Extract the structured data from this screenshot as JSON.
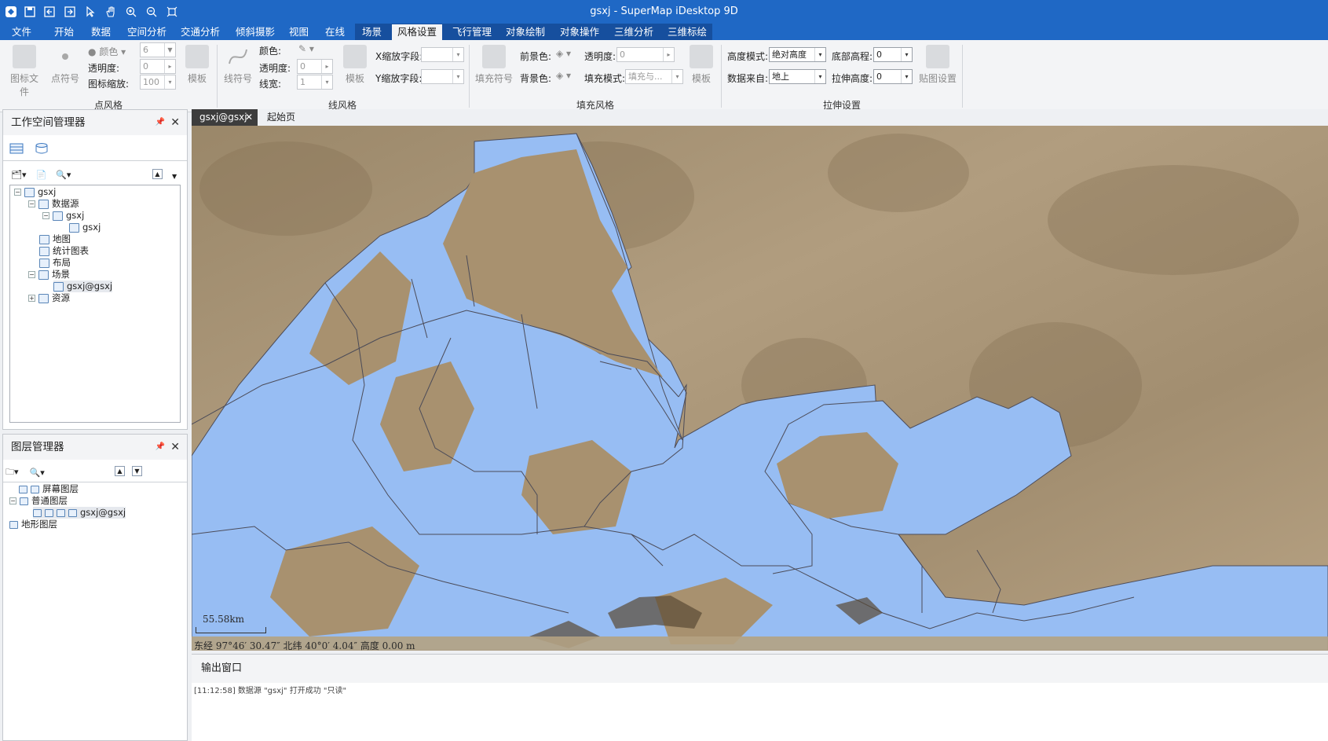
{
  "window": {
    "title": "gsxj - SuperMap iDesktop 9D"
  },
  "quick_access": [
    "app-logo-icon",
    "save-icon",
    "open-icon",
    "close-file-icon",
    "select-icon",
    "pan-icon",
    "zoom-in-icon",
    "zoom-out-icon",
    "full-extent-icon"
  ],
  "menu": {
    "tabs": [
      {
        "label": "文件"
      },
      {
        "label": "开始"
      },
      {
        "label": "数据"
      },
      {
        "label": "空间分析"
      },
      {
        "label": "交通分析"
      },
      {
        "label": "倾斜摄影"
      },
      {
        "label": "视图"
      },
      {
        "label": "在线"
      },
      {
        "label": "场景"
      },
      {
        "label": "风格设置"
      },
      {
        "label": "飞行管理"
      },
      {
        "label": "对象绘制"
      },
      {
        "label": "对象操作"
      },
      {
        "label": "三维分析"
      },
      {
        "label": "三维标绘"
      }
    ],
    "active": "风格设置"
  },
  "ribbon": {
    "point_style": {
      "group": "点风格",
      "icon_file": "图标文件",
      "point_symbol": "点符号",
      "color_label": "颜色",
      "transparency_label": "透明度:",
      "icon_scale_label": "图标缩放:",
      "size_value": "6",
      "transparency_value": "0",
      "scale_value": "100",
      "template": "模板"
    },
    "line_style": {
      "group": "线风格",
      "line_symbol": "线符号",
      "color_label": "颜色:",
      "transparency_label": "透明度:",
      "width_label": "线宽:",
      "transparency_value": "0",
      "width_value": "1",
      "template": "模板",
      "x_scale_label": "X缩放字段:",
      "y_scale_label": "Y缩放字段:"
    },
    "fill_style": {
      "group": "填充风格",
      "fill_symbol": "填充符号",
      "fore_color_label": "前景色:",
      "back_color_label": "背景色:",
      "transparency_label": "透明度:",
      "transparency_value": "0",
      "fill_mode_label": "填充模式:",
      "fill_mode_value": "填充与...",
      "template": "模板"
    },
    "extrude": {
      "group": "拉伸设置",
      "height_mode_label": "高度模式:",
      "height_mode_value": "绝对高度",
      "data_from_label": "数据来自:",
      "data_from_value": "地上",
      "bottom_alt_label": "底部高程:",
      "bottom_alt_value": "0",
      "extrude_height_label": "拉伸高度:",
      "extrude_height_value": "0",
      "texture": "贴图设置"
    }
  },
  "workspace_panel": {
    "title": "工作空间管理器",
    "tree": [
      {
        "label": "gsxj",
        "icon": "workspace-icon"
      },
      {
        "label": "数据源",
        "icon": "datasources-icon"
      },
      {
        "label": "gsxj",
        "icon": "datasource-icon"
      },
      {
        "label": "gsxj",
        "icon": "region-dataset-icon"
      },
      {
        "label": "地图",
        "icon": "maps-icon"
      },
      {
        "label": "统计图表",
        "icon": "charts-icon"
      },
      {
        "label": "布局",
        "icon": "layouts-icon"
      },
      {
        "label": "场景",
        "icon": "scenes-icon"
      },
      {
        "label": "gsxj@gsxj",
        "icon": "globe-icon"
      },
      {
        "label": "资源",
        "icon": "resources-folder-icon"
      }
    ]
  },
  "layer_panel": {
    "title": "图层管理器",
    "tree": [
      {
        "label": "屏幕图层"
      },
      {
        "label": "普通图层"
      },
      {
        "label": "gsxj@gsxj"
      },
      {
        "label": "地形图层"
      }
    ]
  },
  "doc_tabs": [
    {
      "label": "gsxj@gsxj"
    },
    {
      "label": "起始页"
    }
  ],
  "map": {
    "scale_text": "55.58km",
    "status": "东经 97°46′ 30.47″    北纬 40°0′ 4.04″    高度 0.00 m",
    "water_color": "#97bdf3",
    "terrain_color": "#a89577"
  },
  "output": {
    "title": "输出窗口",
    "line": "[11:12:58] 数据源 \"gsxj\" 打开成功 \"只读\""
  }
}
